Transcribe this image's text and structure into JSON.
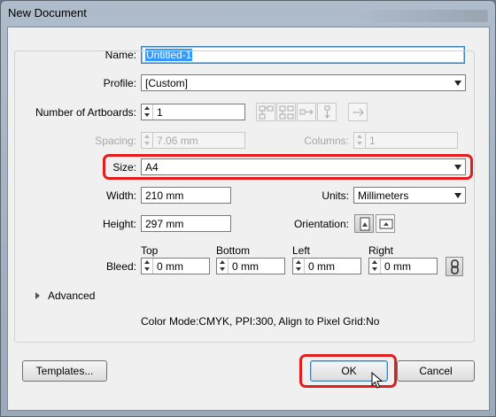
{
  "window": {
    "title": "New Document"
  },
  "name": {
    "label": "Name:",
    "value": "Untitled-1"
  },
  "profile": {
    "label": "Profile:",
    "value": "[Custom]"
  },
  "artboards": {
    "label": "Number of Artboards:",
    "value": "1"
  },
  "spacing": {
    "label": "Spacing:",
    "value": "7.06 mm"
  },
  "columns": {
    "label": "Columns:",
    "value": "1"
  },
  "size": {
    "label": "Size:",
    "value": "A4"
  },
  "width": {
    "label": "Width:",
    "value": "210 mm"
  },
  "units": {
    "label": "Units:",
    "value": "Millimeters"
  },
  "height": {
    "label": "Height:",
    "value": "297 mm"
  },
  "orientation": {
    "label": "Orientation:"
  },
  "bleed": {
    "label": "Bleed:",
    "top": {
      "label": "Top",
      "value": "0 mm"
    },
    "bottom": {
      "label": "Bottom",
      "value": "0 mm"
    },
    "left": {
      "label": "Left",
      "value": "0 mm"
    },
    "right": {
      "label": "Right",
      "value": "0 mm"
    }
  },
  "advanced": {
    "label": "Advanced"
  },
  "info": "Color Mode:CMYK, PPI:300, Align to Pixel Grid:No",
  "buttons": {
    "templates": "Templates...",
    "ok": "OK",
    "cancel": "Cancel"
  },
  "colors": {
    "highlight": "#e51c1c",
    "selection": "#3399ff"
  }
}
